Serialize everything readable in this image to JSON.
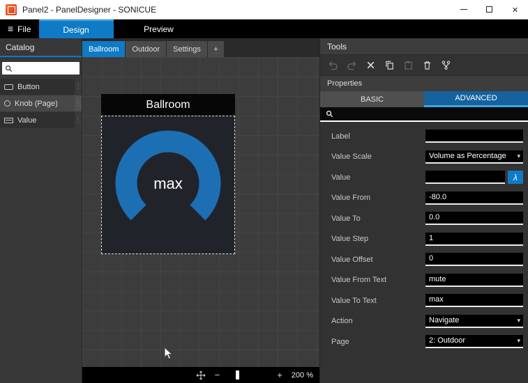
{
  "colors": {
    "accent": "#0f7ac6",
    "accent_light": "#41a5e1",
    "knob_arc": "#1d6fb4",
    "advanced_tab": "#15629e"
  },
  "window": {
    "title": "Panel2 - PanelDesigner - SONICUE"
  },
  "menubar": {
    "file_label": "File",
    "design_label": "Design",
    "preview_label": "Preview"
  },
  "catalog": {
    "title": "Catalog",
    "items": [
      {
        "label": "Button",
        "icon": "button-icon",
        "selected": false
      },
      {
        "label": "Knob (Page)",
        "icon": "knob-icon",
        "selected": true
      },
      {
        "label": "Value",
        "icon": "value-icon",
        "selected": false
      }
    ]
  },
  "canvas": {
    "tabs": [
      {
        "label": "Ballroom",
        "active": true
      },
      {
        "label": "Outdoor",
        "active": false
      },
      {
        "label": "Settings",
        "active": false
      },
      {
        "label": "+",
        "active": false,
        "add": true
      }
    ],
    "widget": {
      "title": "Ballroom",
      "knob_text": "max"
    },
    "zoom": {
      "minus": "−",
      "plus": "+",
      "level": "200 %"
    }
  },
  "tools": {
    "title": "Tools",
    "toolbar": [
      {
        "name": "undo",
        "enabled": false
      },
      {
        "name": "redo",
        "enabled": false
      },
      {
        "name": "delete",
        "enabled": true
      },
      {
        "name": "copy",
        "enabled": true
      },
      {
        "name": "paste",
        "enabled": false
      },
      {
        "name": "trash",
        "enabled": true
      },
      {
        "name": "branch",
        "enabled": true
      }
    ],
    "properties": {
      "title": "Properties",
      "tabs": [
        {
          "label": "BASIC",
          "active": false
        },
        {
          "label": "ADVANCED",
          "active": true
        }
      ],
      "lambda_label": "λ",
      "rows": [
        {
          "label": "Label",
          "value": "",
          "type": "text"
        },
        {
          "label": "Value Scale",
          "value": "Volume as Percentage",
          "type": "select"
        },
        {
          "label": "Value",
          "value": "",
          "type": "lambda"
        },
        {
          "label": "Value From",
          "value": "-80.0",
          "type": "text"
        },
        {
          "label": "Value To",
          "value": "0.0",
          "type": "text"
        },
        {
          "label": "Value Step",
          "value": "1",
          "type": "text"
        },
        {
          "label": "Value Offset",
          "value": "0",
          "type": "text"
        },
        {
          "label": "Value From Text",
          "value": "mute",
          "type": "text"
        },
        {
          "label": "Value To Text",
          "value": "max",
          "type": "text"
        },
        {
          "label": "Action",
          "value": "Navigate",
          "type": "select"
        },
        {
          "label": "Page",
          "value": "2: Outdoor",
          "type": "select"
        }
      ]
    }
  }
}
